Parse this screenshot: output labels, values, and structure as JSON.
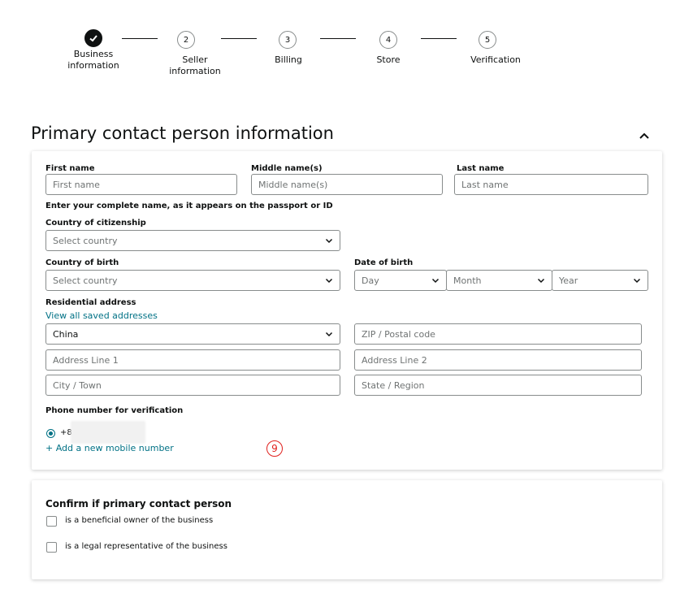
{
  "stepper": {
    "steps": [
      {
        "number": "",
        "label_line1": "Business",
        "label_line2": "information",
        "state": "done"
      },
      {
        "number": "2",
        "label_line1": "Seller",
        "label_line2": "information",
        "state": "current"
      },
      {
        "number": "3",
        "label_line1": "Billing",
        "label_line2": "",
        "state": "todo"
      },
      {
        "number": "4",
        "label_line1": "Store",
        "label_line2": "",
        "state": "todo"
      },
      {
        "number": "5",
        "label_line1": "Verification",
        "label_line2": "",
        "state": "todo"
      }
    ]
  },
  "section": {
    "title": "Primary contact person information",
    "collapse_icon": "chevron-up-icon"
  },
  "name": {
    "first_label": "First name",
    "first_placeholder": "First name",
    "middle_label": "Middle name(s)",
    "middle_placeholder": "Middle name(s)",
    "last_label": "Last name",
    "last_placeholder": "Last name",
    "hint": "Enter your complete name, as it appears on the passport or ID"
  },
  "citizenship": {
    "label": "Country of citizenship",
    "value": "Select country"
  },
  "birth": {
    "country_label": "Country of birth",
    "country_value": "Select country",
    "date_label": "Date of birth",
    "day": "Day",
    "month": "Month",
    "year": "Year"
  },
  "address": {
    "label": "Residential address",
    "saved_link": "View all saved addresses",
    "country_value": "China",
    "zip_placeholder": "ZIP / Postal code",
    "line1_placeholder": "Address Line 1",
    "line2_placeholder": "Address Line 2",
    "city_placeholder": "City / Town",
    "state_placeholder": "State / Region"
  },
  "phone": {
    "label": "Phone number for verification",
    "prefix": "+8",
    "add_link": "+ Add a new mobile number",
    "marker": "9"
  },
  "confirm": {
    "title": "Confirm if primary contact person",
    "option1": "is a beneficial owner of the business",
    "option2": "is a legal representative of the business"
  },
  "colors": {
    "link": "#007185",
    "border": "#888c8c",
    "text": "#0f1111",
    "marker": "#e0201d"
  }
}
